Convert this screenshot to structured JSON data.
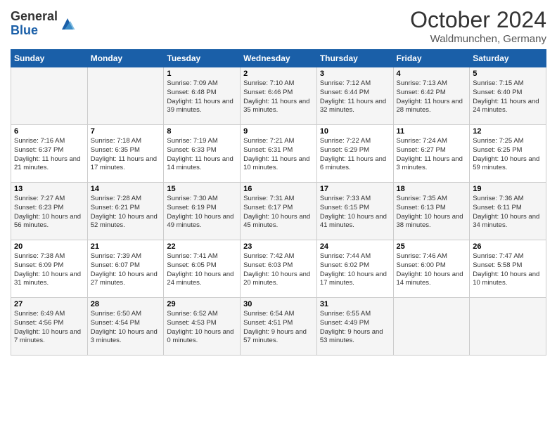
{
  "header": {
    "logo_general": "General",
    "logo_blue": "Blue",
    "month": "October 2024",
    "location": "Waldmunchen, Germany"
  },
  "days_of_week": [
    "Sunday",
    "Monday",
    "Tuesday",
    "Wednesday",
    "Thursday",
    "Friday",
    "Saturday"
  ],
  "weeks": [
    [
      {
        "day": "",
        "sunrise": "",
        "sunset": "",
        "daylight": ""
      },
      {
        "day": "",
        "sunrise": "",
        "sunset": "",
        "daylight": ""
      },
      {
        "day": "1",
        "sunrise": "Sunrise: 7:09 AM",
        "sunset": "Sunset: 6:48 PM",
        "daylight": "Daylight: 11 hours and 39 minutes."
      },
      {
        "day": "2",
        "sunrise": "Sunrise: 7:10 AM",
        "sunset": "Sunset: 6:46 PM",
        "daylight": "Daylight: 11 hours and 35 minutes."
      },
      {
        "day": "3",
        "sunrise": "Sunrise: 7:12 AM",
        "sunset": "Sunset: 6:44 PM",
        "daylight": "Daylight: 11 hours and 32 minutes."
      },
      {
        "day": "4",
        "sunrise": "Sunrise: 7:13 AM",
        "sunset": "Sunset: 6:42 PM",
        "daylight": "Daylight: 11 hours and 28 minutes."
      },
      {
        "day": "5",
        "sunrise": "Sunrise: 7:15 AM",
        "sunset": "Sunset: 6:40 PM",
        "daylight": "Daylight: 11 hours and 24 minutes."
      }
    ],
    [
      {
        "day": "6",
        "sunrise": "Sunrise: 7:16 AM",
        "sunset": "Sunset: 6:37 PM",
        "daylight": "Daylight: 11 hours and 21 minutes."
      },
      {
        "day": "7",
        "sunrise": "Sunrise: 7:18 AM",
        "sunset": "Sunset: 6:35 PM",
        "daylight": "Daylight: 11 hours and 17 minutes."
      },
      {
        "day": "8",
        "sunrise": "Sunrise: 7:19 AM",
        "sunset": "Sunset: 6:33 PM",
        "daylight": "Daylight: 11 hours and 14 minutes."
      },
      {
        "day": "9",
        "sunrise": "Sunrise: 7:21 AM",
        "sunset": "Sunset: 6:31 PM",
        "daylight": "Daylight: 11 hours and 10 minutes."
      },
      {
        "day": "10",
        "sunrise": "Sunrise: 7:22 AM",
        "sunset": "Sunset: 6:29 PM",
        "daylight": "Daylight: 11 hours and 6 minutes."
      },
      {
        "day": "11",
        "sunrise": "Sunrise: 7:24 AM",
        "sunset": "Sunset: 6:27 PM",
        "daylight": "Daylight: 11 hours and 3 minutes."
      },
      {
        "day": "12",
        "sunrise": "Sunrise: 7:25 AM",
        "sunset": "Sunset: 6:25 PM",
        "daylight": "Daylight: 10 hours and 59 minutes."
      }
    ],
    [
      {
        "day": "13",
        "sunrise": "Sunrise: 7:27 AM",
        "sunset": "Sunset: 6:23 PM",
        "daylight": "Daylight: 10 hours and 56 minutes."
      },
      {
        "day": "14",
        "sunrise": "Sunrise: 7:28 AM",
        "sunset": "Sunset: 6:21 PM",
        "daylight": "Daylight: 10 hours and 52 minutes."
      },
      {
        "day": "15",
        "sunrise": "Sunrise: 7:30 AM",
        "sunset": "Sunset: 6:19 PM",
        "daylight": "Daylight: 10 hours and 49 minutes."
      },
      {
        "day": "16",
        "sunrise": "Sunrise: 7:31 AM",
        "sunset": "Sunset: 6:17 PM",
        "daylight": "Daylight: 10 hours and 45 minutes."
      },
      {
        "day": "17",
        "sunrise": "Sunrise: 7:33 AM",
        "sunset": "Sunset: 6:15 PM",
        "daylight": "Daylight: 10 hours and 41 minutes."
      },
      {
        "day": "18",
        "sunrise": "Sunrise: 7:35 AM",
        "sunset": "Sunset: 6:13 PM",
        "daylight": "Daylight: 10 hours and 38 minutes."
      },
      {
        "day": "19",
        "sunrise": "Sunrise: 7:36 AM",
        "sunset": "Sunset: 6:11 PM",
        "daylight": "Daylight: 10 hours and 34 minutes."
      }
    ],
    [
      {
        "day": "20",
        "sunrise": "Sunrise: 7:38 AM",
        "sunset": "Sunset: 6:09 PM",
        "daylight": "Daylight: 10 hours and 31 minutes."
      },
      {
        "day": "21",
        "sunrise": "Sunrise: 7:39 AM",
        "sunset": "Sunset: 6:07 PM",
        "daylight": "Daylight: 10 hours and 27 minutes."
      },
      {
        "day": "22",
        "sunrise": "Sunrise: 7:41 AM",
        "sunset": "Sunset: 6:05 PM",
        "daylight": "Daylight: 10 hours and 24 minutes."
      },
      {
        "day": "23",
        "sunrise": "Sunrise: 7:42 AM",
        "sunset": "Sunset: 6:03 PM",
        "daylight": "Daylight: 10 hours and 20 minutes."
      },
      {
        "day": "24",
        "sunrise": "Sunrise: 7:44 AM",
        "sunset": "Sunset: 6:02 PM",
        "daylight": "Daylight: 10 hours and 17 minutes."
      },
      {
        "day": "25",
        "sunrise": "Sunrise: 7:46 AM",
        "sunset": "Sunset: 6:00 PM",
        "daylight": "Daylight: 10 hours and 14 minutes."
      },
      {
        "day": "26",
        "sunrise": "Sunrise: 7:47 AM",
        "sunset": "Sunset: 5:58 PM",
        "daylight": "Daylight: 10 hours and 10 minutes."
      }
    ],
    [
      {
        "day": "27",
        "sunrise": "Sunrise: 6:49 AM",
        "sunset": "Sunset: 4:56 PM",
        "daylight": "Daylight: 10 hours and 7 minutes."
      },
      {
        "day": "28",
        "sunrise": "Sunrise: 6:50 AM",
        "sunset": "Sunset: 4:54 PM",
        "daylight": "Daylight: 10 hours and 3 minutes."
      },
      {
        "day": "29",
        "sunrise": "Sunrise: 6:52 AM",
        "sunset": "Sunset: 4:53 PM",
        "daylight": "Daylight: 10 hours and 0 minutes."
      },
      {
        "day": "30",
        "sunrise": "Sunrise: 6:54 AM",
        "sunset": "Sunset: 4:51 PM",
        "daylight": "Daylight: 9 hours and 57 minutes."
      },
      {
        "day": "31",
        "sunrise": "Sunrise: 6:55 AM",
        "sunset": "Sunset: 4:49 PM",
        "daylight": "Daylight: 9 hours and 53 minutes."
      },
      {
        "day": "",
        "sunrise": "",
        "sunset": "",
        "daylight": ""
      },
      {
        "day": "",
        "sunrise": "",
        "sunset": "",
        "daylight": ""
      }
    ]
  ]
}
